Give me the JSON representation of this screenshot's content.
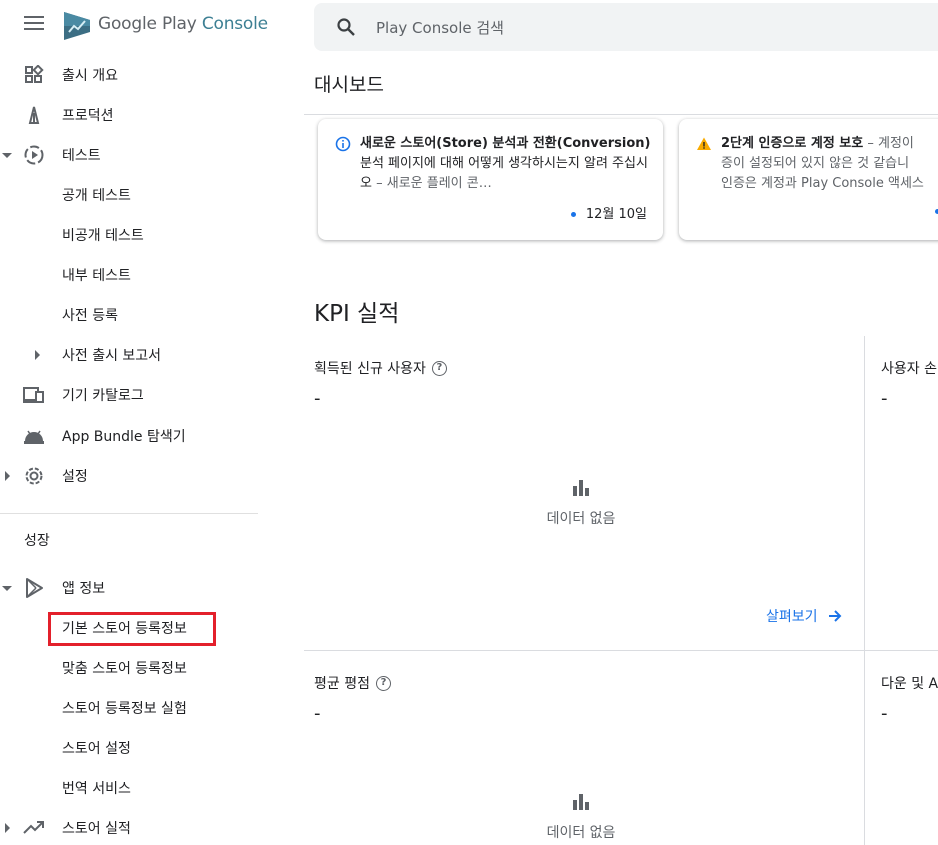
{
  "brand": {
    "google_play": "Google Play",
    "console": "Console"
  },
  "search": {
    "placeholder": "Play Console 검색"
  },
  "sidebar": {
    "items": [
      {
        "label": "출시 개요",
        "icon": "dashboard-grid-icon"
      },
      {
        "label": "프로덕션",
        "icon": "lighthouse-icon"
      },
      {
        "label": "테스트",
        "icon": "play-circle-dashed-icon"
      },
      {
        "label": "공개 테스트"
      },
      {
        "label": "비공개 테스트"
      },
      {
        "label": "내부 테스트"
      },
      {
        "label": "사전 등록"
      },
      {
        "label": "사전 출시 보고서"
      },
      {
        "label": "기기 카탈로그",
        "icon": "devices-icon"
      },
      {
        "label": "App Bundle 탐색기",
        "icon": "android-icon"
      },
      {
        "label": "설정",
        "icon": "gear-icon"
      }
    ],
    "section_title": "성장",
    "growth_items": [
      {
        "label": "앱 정보",
        "icon": "play-outline-icon"
      },
      {
        "label": "기본 스토어 등록정보"
      },
      {
        "label": "맞춤 스토어 등록정보"
      },
      {
        "label": "스토어 등록정보 실험"
      },
      {
        "label": "스토어 설정"
      },
      {
        "label": "번역 서비스"
      },
      {
        "label": "스토어 실적",
        "icon": "trending-up-icon"
      }
    ]
  },
  "main": {
    "page_title": "대시보드",
    "cards": [
      {
        "bold": "새로운 스토어(Store) 분석과 전환(Conversion)",
        "text": " 분석 페이지에 대해 어떻게 생각하시는지 알려 주십시오",
        "muted": " – 새로운 플레이 콘…",
        "date": "12월 10일",
        "icon": "info-icon"
      },
      {
        "bold": "2단계 인증으로 계정 보호",
        "muted": " – 계정이",
        "line2": "증이 설정되어 있지 않은 것 같습니",
        "line3": "인증은 계정과 Play Console 액세스",
        "icon": "warning-icon"
      }
    ],
    "kpi_title": "KPI 실적",
    "metrics": [
      {
        "label": "획득된 신규 사용자",
        "value": "-"
      },
      {
        "label": "사용자 손",
        "value": "-"
      },
      {
        "label": "평균 평점",
        "value": "-"
      },
      {
        "label": "다운 및 A",
        "value": "-"
      }
    ],
    "no_data": "데이터 없음",
    "explore": "살펴보기"
  },
  "colors": {
    "accent": "#1a73e8",
    "highlight": "#e3202b",
    "warning": "#f9ab00"
  }
}
